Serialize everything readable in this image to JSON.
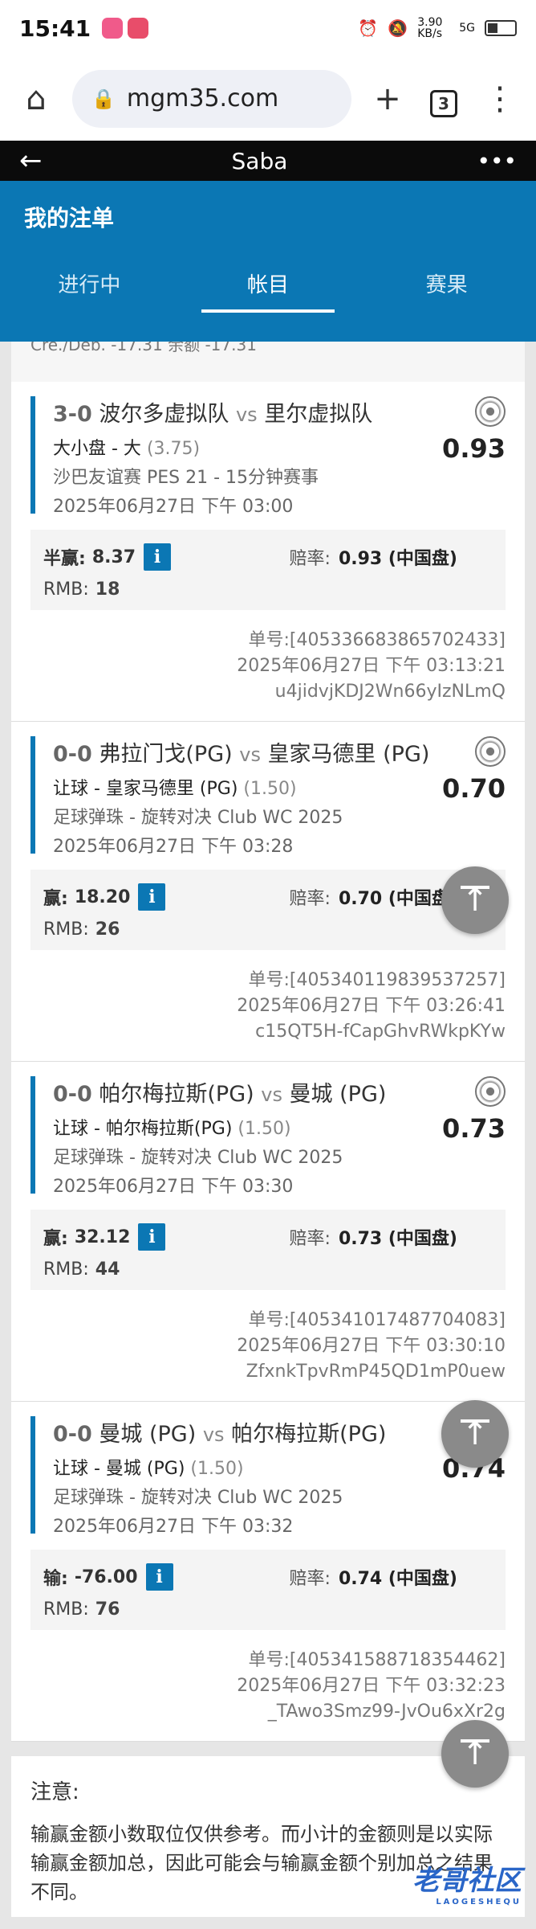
{
  "status": {
    "time": "15:41",
    "network": "3.90 KB/s",
    "signal": "5G"
  },
  "browser": {
    "url": "mgm35.com",
    "tab_count": "3"
  },
  "app": {
    "title": "Saba"
  },
  "header": {
    "title": "我的注单",
    "tabs": [
      "进行中",
      "帐目",
      "赛果"
    ],
    "active_tab": 1
  },
  "partial_line": "Cre./Deb. -17.31 余额 -17.31",
  "bets": [
    {
      "score": "3-0",
      "home": "波尔多虚拟队",
      "vs": "vs",
      "away": "里尔虚拟队",
      "bet_type": "大小盘 - 大",
      "handicap": "(3.75)",
      "league": "沙巴友谊赛 PES 21 - 15分钟赛事",
      "match_time": "2025年06月27日 下午 03:00",
      "odds": "0.93",
      "result_label": "半赢:",
      "result_value": "8.37",
      "ratio_label": "赔率:",
      "ratio_value": "0.93 (中国盘)",
      "stake_label": "RMB:",
      "stake": "18",
      "ticket": "单号:[405336683865702433]",
      "bet_time": "2025年06月27日 下午 03:13:21",
      "code": "u4jidvjKDJ2Wn66yIzNLmQ"
    },
    {
      "score": "0-0",
      "home": "弗拉门戈(PG)",
      "vs": "vs",
      "away": "皇家马德里 (PG)",
      "bet_type": "让球 - 皇家马德里 (PG)",
      "handicap": "(1.50)",
      "league": "足球弹珠 - 旋转对决 Club WC 2025",
      "match_time": "2025年06月27日 下午 03:28",
      "odds": "0.70",
      "result_label": "赢:",
      "result_value": "18.20",
      "ratio_label": "赔率:",
      "ratio_value": "0.70 (中国盘)",
      "stake_label": "RMB:",
      "stake": "26",
      "ticket": "单号:[405340119839537257]",
      "bet_time": "2025年06月27日 下午 03:26:41",
      "code": "c15QT5H-fCapGhvRWkpKYw"
    },
    {
      "score": "0-0",
      "home": "帕尔梅拉斯(PG)",
      "vs": "vs",
      "away": "曼城 (PG)",
      "bet_type": "让球 - 帕尔梅拉斯(PG)",
      "handicap": "(1.50)",
      "league": "足球弹珠 - 旋转对决 Club WC 2025",
      "match_time": "2025年06月27日 下午 03:30",
      "odds": "0.73",
      "result_label": "赢:",
      "result_value": "32.12",
      "ratio_label": "赔率:",
      "ratio_value": "0.73 (中国盘)",
      "stake_label": "RMB:",
      "stake": "44",
      "ticket": "单号:[405341017487704083]",
      "bet_time": "2025年06月27日 下午 03:30:10",
      "code": "ZfxnkTpvRmP45QD1mP0uew"
    },
    {
      "score": "0-0",
      "home": "曼城 (PG)",
      "vs": "vs",
      "away": "帕尔梅拉斯(PG)",
      "bet_type": "让球 - 曼城 (PG)",
      "handicap": "(1.50)",
      "league": "足球弹珠 - 旋转对决 Club WC 2025",
      "match_time": "2025年06月27日 下午 03:32",
      "odds": "0.74",
      "result_label": "输:",
      "result_value": "-76.00",
      "ratio_label": "赔率:",
      "ratio_value": "0.74 (中国盘)",
      "stake_label": "RMB:",
      "stake": "76",
      "ticket": "单号:[405341588718354462]",
      "bet_time": "2025年06月27日 下午 03:32:23",
      "code": "_TAwo3Smz99-JvOu6xXr2g"
    }
  ],
  "note": {
    "title": "注意:",
    "body": "输赢金额小数取位仅供参考。而小计的金额则是以实际输赢金额加总，因此可能会与输赢金额个别加总之结果不同。"
  },
  "watermark": {
    "text": "老哥社区",
    "sub": "LAOGESHEQU"
  }
}
